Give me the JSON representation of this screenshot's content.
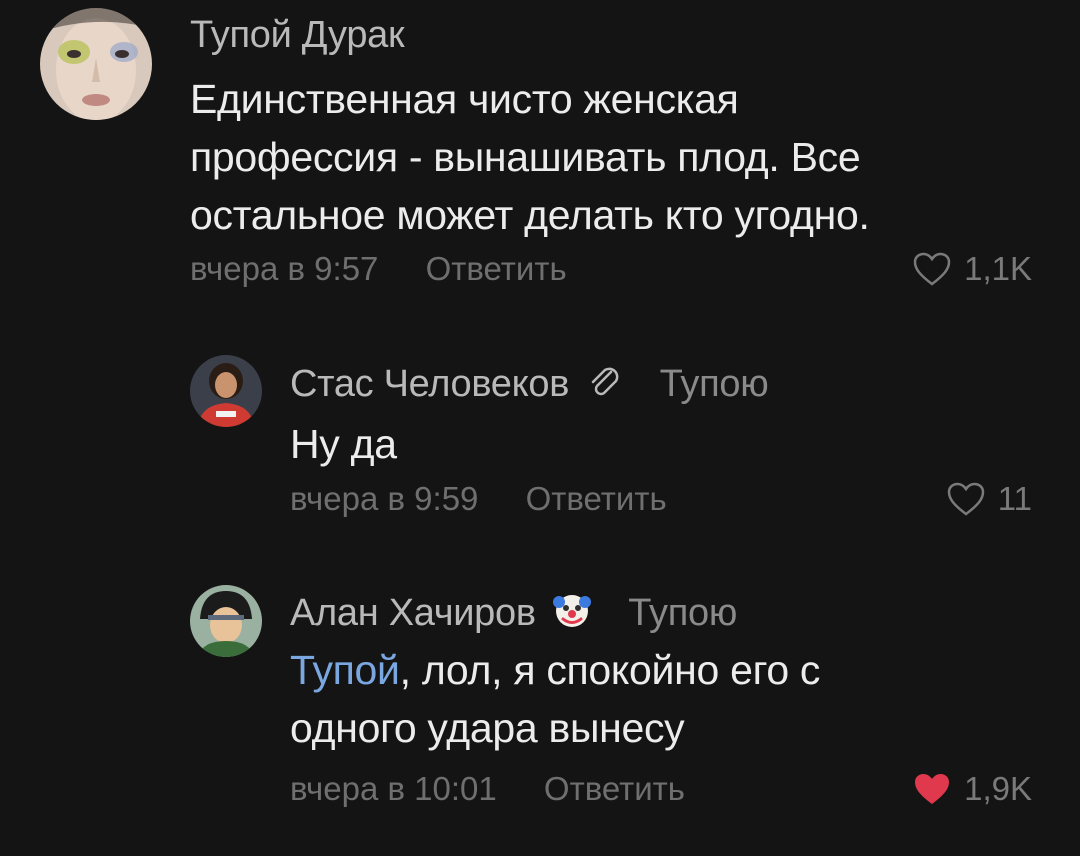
{
  "comments": [
    {
      "author": "Тупой Дурак",
      "lines": [
        "Единственная чисто женская",
        "профессия - вынашивать плод. Все",
        "остальное может делать кто угодно."
      ],
      "time": "вчера в 9:57",
      "reply_label": "Ответить",
      "likes": "1,1K",
      "liked": false
    },
    {
      "author": "Стас Человеков",
      "badge": "paperclip-icon",
      "reply_to": "Тупою",
      "lines": [
        "Ну да"
      ],
      "time": "вчера в 9:59",
      "reply_label": "Ответить",
      "likes": "11",
      "liked": false
    },
    {
      "author": "Алан Хачиров",
      "badge": "clown-emoji",
      "reply_to": "Тупою",
      "mention": "Тупой",
      "line1_rest": ", лол, я спокойно его с",
      "line2": "одного удара вынесу",
      "time": "вчера в 10:01",
      "reply_label": "Ответить",
      "likes": "1,9K",
      "liked": true
    }
  ],
  "colors": {
    "background": "#141414",
    "mention": "#7aa7e0",
    "liked_heart": "#e0384d"
  }
}
